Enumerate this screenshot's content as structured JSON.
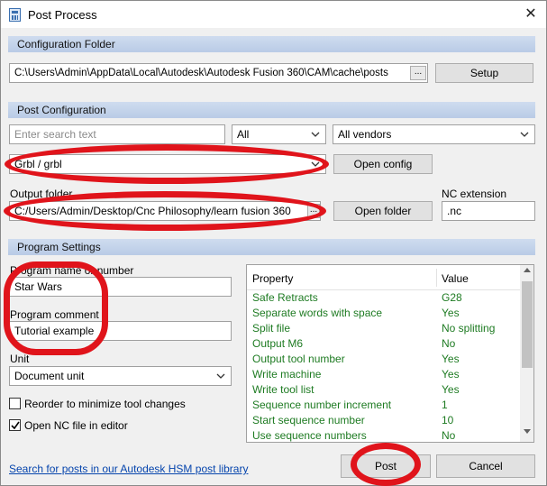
{
  "window": {
    "title": "Post Process",
    "close_glyph": "✕"
  },
  "config_folder": {
    "header": "Configuration Folder",
    "path": "C:\\Users\\Admin\\AppData\\Local\\Autodesk\\Autodesk Fusion 360\\CAM\\cache\\posts",
    "browse_label": "...",
    "setup_label": "Setup"
  },
  "post_config": {
    "header": "Post Configuration",
    "search_placeholder": "Enter search text",
    "filter_all": "All",
    "vendor_filter": "All vendors",
    "post_selected": "Grbl / grbl",
    "open_config_label": "Open config",
    "output_folder_label": "Output folder",
    "output_folder_path": "C:/Users/Admin/Desktop/Cnc Philosophy/learn fusion 360",
    "output_browse_label": "...",
    "open_folder_label": "Open folder",
    "nc_extension_label": "NC extension",
    "nc_extension_value": ".nc"
  },
  "program_settings": {
    "header": "Program Settings",
    "program_name_label": "Program name or number",
    "program_name_value": "Star Wars",
    "program_comment_label": "Program comment",
    "program_comment_value": "Tutorial example",
    "unit_label": "Unit",
    "unit_value": "Document unit",
    "reorder_label": "Reorder to minimize tool changes",
    "reorder_checked": false,
    "open_nc_label": "Open NC file in editor",
    "open_nc_checked": true
  },
  "properties": {
    "col_property": "Property",
    "col_value": "Value",
    "rows": [
      {
        "name": "Safe Retracts",
        "value": "G28"
      },
      {
        "name": "Separate words with space",
        "value": "Yes"
      },
      {
        "name": "Split file",
        "value": "No splitting"
      },
      {
        "name": "Output M6",
        "value": "No"
      },
      {
        "name": "Output tool number",
        "value": "Yes"
      },
      {
        "name": "Write machine",
        "value": "Yes"
      },
      {
        "name": "Write tool list",
        "value": "Yes"
      },
      {
        "name": "Sequence number increment",
        "value": "1"
      },
      {
        "name": "Start sequence number",
        "value": "10"
      },
      {
        "name": "Use sequence numbers",
        "value": "No"
      }
    ]
  },
  "footer": {
    "link_text": "Search for posts in our Autodesk HSM post library",
    "post_label": "Post",
    "cancel_label": "Cancel"
  },
  "colors": {
    "accent_header": "#c4d4ec",
    "property_text": "#1e7b22",
    "annotation_ring": "#e0141b",
    "link": "#0645ad"
  },
  "icons": [
    "app-icon",
    "close-icon",
    "chevron-down-icon",
    "checkmark-icon",
    "scroll-up-icon",
    "scroll-down-icon"
  ]
}
